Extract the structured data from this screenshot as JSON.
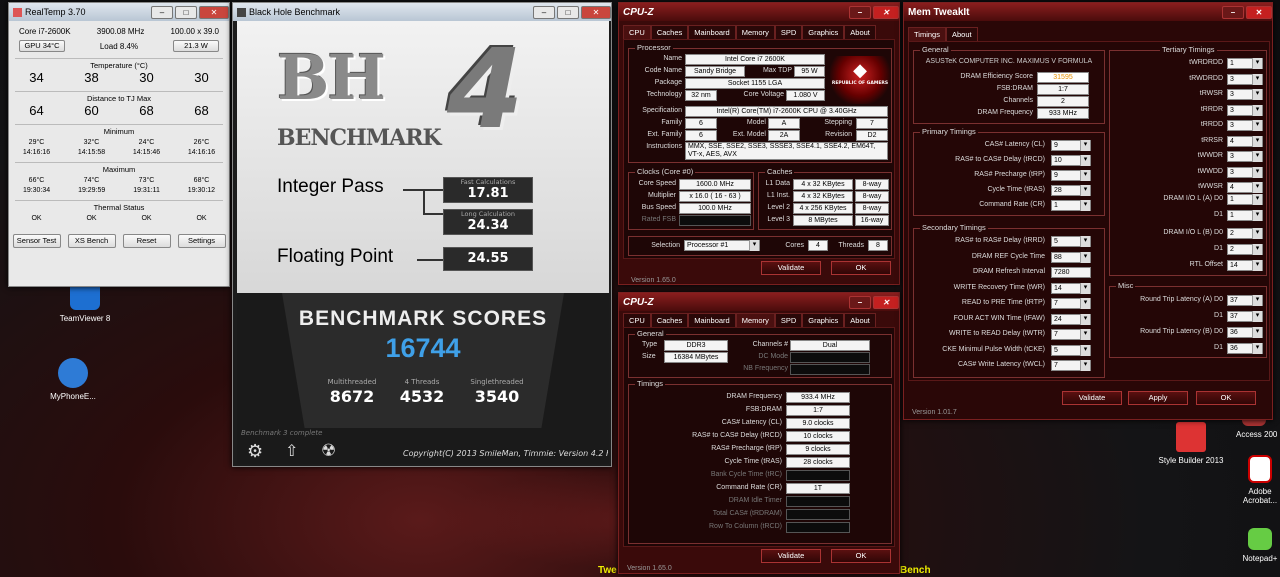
{
  "desktop": {
    "icons": [
      {
        "label": "TeamViewer 8"
      },
      {
        "label": "MyPhoneE..."
      },
      {
        "label": "Style Builder 2013"
      },
      {
        "label": "Access 200"
      },
      {
        "label": "Adobe Acrobat..."
      },
      {
        "label": "Notepad+"
      }
    ],
    "taskbar_left": "Twe",
    "taskbar_right": "Bench"
  },
  "realtemp": {
    "title": "RealTemp 3.70",
    "cpu": "Core i7-2600K",
    "freq": "3900.08 MHz",
    "mult": "100.00 x 39.0",
    "gpu_btn": "GPU 34°C",
    "load": "Load 8.4%",
    "power": "21.3 W",
    "temp_title": "Temperature (°C)",
    "temps": [
      "34",
      "38",
      "30",
      "30"
    ],
    "dist_title": "Distance to TJ Max",
    "dist": [
      "64",
      "60",
      "68",
      "68"
    ],
    "min_title": "Minimum",
    "min_vals": [
      "29°C",
      "32°C",
      "24°C",
      "26°C"
    ],
    "min_times": [
      "14:16:16",
      "14:15:58",
      "14:15:46",
      "14:16:16"
    ],
    "max_title": "Maximum",
    "max_vals": [
      "66°C",
      "74°C",
      "73°C",
      "68°C"
    ],
    "max_times": [
      "19:30:34",
      "19:29:59",
      "19:31:11",
      "19:30:12"
    ],
    "thermal_title": "Thermal Status",
    "thermal": [
      "OK",
      "OK",
      "OK",
      "OK"
    ],
    "buttons": [
      "Sensor Test",
      "XS Bench",
      "Reset",
      "Settings"
    ]
  },
  "bh": {
    "title": "Black Hole Benchmark",
    "logo_bh": "BH",
    "logo_4": "4",
    "logo_bench": "BENCHMARK",
    "int_label": "Integer Pass",
    "fast_label": "Fast Calculations",
    "fast_val": "17.81",
    "long_label": "Long Calculation",
    "long_val": "24.34",
    "fp_label": "Floating Point",
    "fp_val": "24.55",
    "scores_title": "BENCHMARK SCORES",
    "score": "16744",
    "multi_label": "Multithreaded",
    "multi_val": "8672",
    "four_label": "4 Threads",
    "four_val": "4532",
    "single_label": "Singlethreaded",
    "single_val": "3540",
    "status": "Benchmark 3 complete",
    "copyright": "Copyright(C) 2013 SmileMan, Timmie: Version 4.2 F"
  },
  "cpuz1": {
    "title": "CPU-Z",
    "tabs": [
      "CPU",
      "Caches",
      "Mainboard",
      "Memory",
      "SPD",
      "Graphics",
      "About"
    ],
    "proc_title": "Processor",
    "name_l": "Name",
    "name": "Intel Core i7 2600K",
    "code_l": "Code Name",
    "code": "Sandy Bridge",
    "tdp_l": "Max TDP",
    "tdp": "95 W",
    "pkg_l": "Package",
    "pkg": "Socket 1155 LGA",
    "tech_l": "Technology",
    "tech": "32 nm",
    "cv_l": "Core Voltage",
    "cv": "1.080 V",
    "spec_l": "Specification",
    "spec": "Intel(R) Core(TM) i7-2600K CPU @ 3.40GHz",
    "fam_l": "Family",
    "fam": "6",
    "model_l": "Model",
    "model": "A",
    "step_l": "Stepping",
    "step": "7",
    "efam_l": "Ext. Family",
    "efam": "6",
    "emodel_l": "Ext. Model",
    "emodel": "2A",
    "rev_l": "Revision",
    "rev": "D2",
    "instr_l": "Instructions",
    "instr": "MMX, SSE, SSE2, SSE3, SSSE3, SSE4.1, SSE4.2, EM64T, VT-x, AES, AVX",
    "rog": "REPUBLIC OF GAMERS",
    "clocks_title": "Clocks (Core #0)",
    "cs_l": "Core Speed",
    "cs": "1600.0 MHz",
    "mul_l": "Multiplier",
    "mul": "x 16.0 ( 16 - 63 )",
    "bus_l": "Bus Speed",
    "bus": "100.0 MHz",
    "fsb_l": "Rated FSB",
    "caches_title": "Caches",
    "l1d_l": "L1 Data",
    "l1d": "4 x 32 KBytes",
    "l1d_w": "8-way",
    "l1i_l": "L1 Inst.",
    "l1i": "4 x 32 KBytes",
    "l1i_w": "8-way",
    "l2_l": "Level 2",
    "l2": "4 x 256 KBytes",
    "l2_w": "8-way",
    "l3_l": "Level 3",
    "l3": "8 MBytes",
    "l3_w": "16-way",
    "sel_l": "Selection",
    "sel": "Processor #1",
    "cores_l": "Cores",
    "cores": "4",
    "threads_l": "Threads",
    "threads": "8",
    "version": "Version 1.65.0",
    "validate": "Validate",
    "ok": "OK"
  },
  "cpuz2": {
    "title": "CPU-Z",
    "tabs": [
      "CPU",
      "Caches",
      "Mainboard",
      "Memory",
      "SPD",
      "Graphics",
      "About"
    ],
    "gen_title": "General",
    "type_l": "Type",
    "type": "DDR3",
    "ch_l": "Channels #",
    "ch": "Dual",
    "size_l": "Size",
    "size": "16384 MBytes",
    "dc_l": "DC Mode",
    "nb_l": "NB Frequency",
    "tim_title": "Timings",
    "rows": [
      {
        "l": "DRAM Frequency",
        "v": "933.4 MHz",
        "dim": false
      },
      {
        "l": "FSB:DRAM",
        "v": "1:7",
        "dim": false
      },
      {
        "l": "CAS# Latency (CL)",
        "v": "9.0 clocks",
        "dim": false
      },
      {
        "l": "RAS# to CAS# Delay (tRCD)",
        "v": "10 clocks",
        "dim": false
      },
      {
        "l": "RAS# Precharge (tRP)",
        "v": "9 clocks",
        "dim": false
      },
      {
        "l": "Cycle Time (tRAS)",
        "v": "28 clocks",
        "dim": false
      },
      {
        "l": "Bank Cycle Time (tRC)",
        "v": "",
        "dim": true
      },
      {
        "l": "Command Rate (CR)",
        "v": "1T",
        "dim": false
      },
      {
        "l": "DRAM Idle Timer",
        "v": "",
        "dim": true
      },
      {
        "l": "Total CAS# (tRDRAM)",
        "v": "",
        "dim": true
      },
      {
        "l": "Row To Column (tRCD)",
        "v": "",
        "dim": true
      }
    ],
    "version": "Version 1.65.0",
    "validate": "Validate",
    "ok": "OK"
  },
  "mt": {
    "title": "Mem TweakIt",
    "tabs": [
      "Timings",
      "About"
    ],
    "gen_title": "General",
    "board": "ASUSTeK COMPUTER INC. MAXIMUS V FORMULA",
    "gen_rows": [
      {
        "l": "DRAM Efficiency Score",
        "v": "31595",
        "hl": true
      },
      {
        "l": "FSB:DRAM",
        "v": "1:7",
        "hl": false
      },
      {
        "l": "Channels",
        "v": "2",
        "hl": false
      },
      {
        "l": "DRAM Frequency",
        "v": "933 MHz",
        "hl": false
      }
    ],
    "prim_title": "Primary Timings",
    "prim": [
      {
        "l": "CAS# Latency (CL)",
        "v": "9"
      },
      {
        "l": "RAS# to CAS# Delay (tRCD)",
        "v": "10"
      },
      {
        "l": "RAS# Precharge (tRP)",
        "v": "9"
      },
      {
        "l": "Cycle Time (tRAS)",
        "v": "28"
      },
      {
        "l": "Command Rate (CR)",
        "v": "1"
      }
    ],
    "sec_title": "Secondary Timings",
    "sec": [
      {
        "l": "RAS# to RAS# Delay (tRRD)",
        "v": "5",
        "sel": true
      },
      {
        "l": "DRAM REF Cycle Time",
        "v": "88",
        "sel": true
      },
      {
        "l": "DRAM Refresh Interval",
        "v": "7280",
        "sel": false
      },
      {
        "l": "WRITE Recovery Time (tWR)",
        "v": "14",
        "sel": true
      },
      {
        "l": "READ to PRE Time (tRTP)",
        "v": "7",
        "sel": true
      },
      {
        "l": "FOUR ACT WIN Time (tFAW)",
        "v": "24",
        "sel": true
      },
      {
        "l": "WRITE to READ Delay (tWTR)",
        "v": "7",
        "sel": true
      },
      {
        "l": "CKE Minimul Pulse Width (tCKE)",
        "v": "5",
        "sel": true
      },
      {
        "l": "CAS# Write Latency (tWCL)",
        "v": "7",
        "sel": true
      }
    ],
    "ter_title": "Tertiary Timings",
    "ter": [
      {
        "l": "tWRDRDD",
        "v": "1"
      },
      {
        "l": "tRWDRDD",
        "v": "3"
      },
      {
        "l": "tRWSR",
        "v": "3"
      },
      {
        "l": "tRRDR",
        "v": "3"
      },
      {
        "l": "tRRDD",
        "v": "3"
      },
      {
        "l": "tRRSR",
        "v": "4"
      },
      {
        "l": "tWWDR",
        "v": "3"
      },
      {
        "l": "tWWDD",
        "v": "3"
      },
      {
        "l": "tWWSR",
        "v": "4"
      }
    ],
    "dram_a_l": "DRAM I/O L (A)  D0",
    "dram_a": "1",
    "d1a_l": "D1",
    "d1a": "1",
    "dram_b_l": "DRAM I/O L (B)  D0",
    "dram_b": "2",
    "d1b_l": "D1",
    "d1b": "2",
    "rtl_l": "RTL Offset",
    "rtl": "14",
    "misc_title": "Misc",
    "rtla_l": "Round Trip Latency (A)  D0",
    "rtla": "37",
    "rtla1_l": "D1",
    "rtla1": "37",
    "rtlb_l": "Round Trip Latency (B)  D0",
    "rtlb": "36",
    "rtlb1_l": "D1",
    "rtlb1": "36",
    "version": "Version 1.01.7",
    "validate": "Validate",
    "apply": "Apply",
    "ok": "OK"
  }
}
